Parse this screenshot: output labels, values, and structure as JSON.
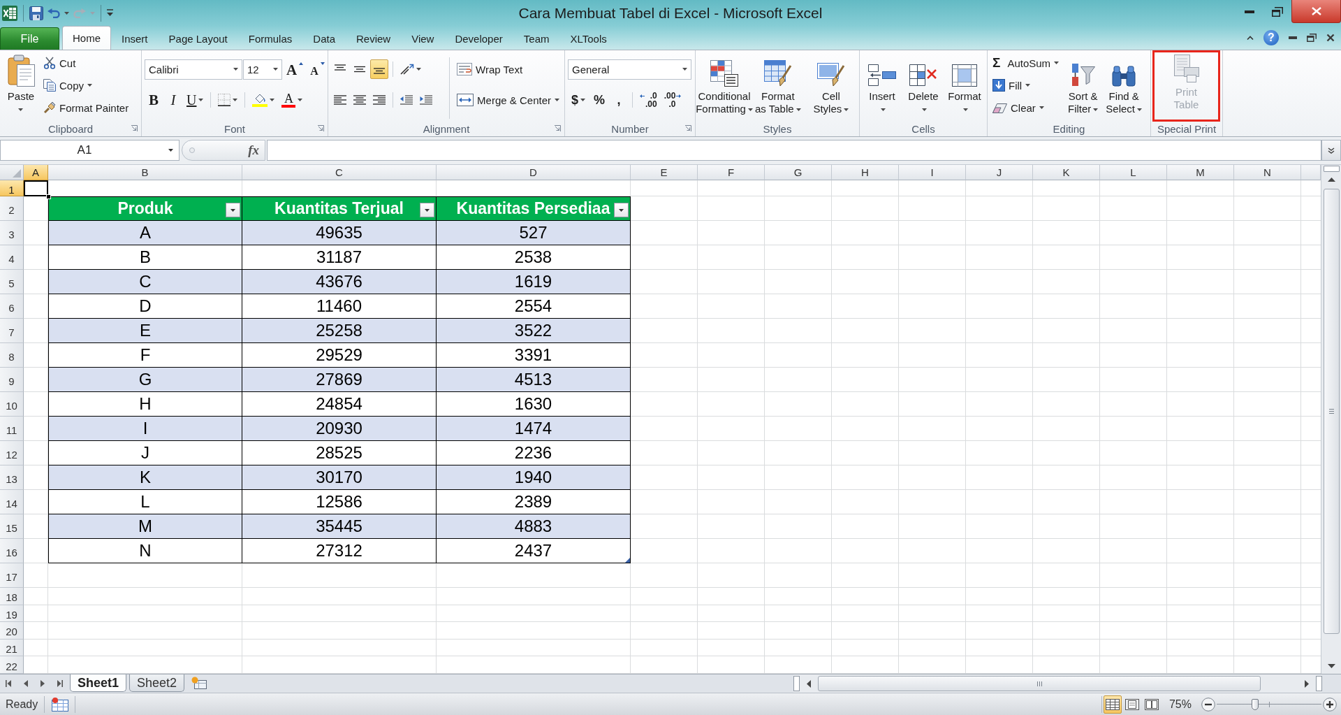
{
  "window": {
    "title": "Cara Membuat Tabel di Excel - Microsoft Excel"
  },
  "quick_access": [
    {
      "kind": "save",
      "disabled": false
    },
    {
      "kind": "undo",
      "disabled": false
    },
    {
      "kind": "redo",
      "disabled": true
    }
  ],
  "ribbon_tabs": [
    {
      "label": "File",
      "kind": "file",
      "selected": false
    },
    {
      "label": "Home",
      "kind": "tab",
      "selected": true
    },
    {
      "label": "Insert",
      "kind": "tab",
      "selected": false
    },
    {
      "label": "Page Layout",
      "kind": "tab",
      "selected": false
    },
    {
      "label": "Formulas",
      "kind": "tab",
      "selected": false
    },
    {
      "label": "Data",
      "kind": "tab",
      "selected": false
    },
    {
      "label": "Review",
      "kind": "tab",
      "selected": false
    },
    {
      "label": "View",
      "kind": "tab",
      "selected": false
    },
    {
      "label": "Developer",
      "kind": "tab",
      "selected": false
    },
    {
      "label": "Team",
      "kind": "tab",
      "selected": false
    },
    {
      "label": "XLTools",
      "kind": "tab",
      "selected": false
    }
  ],
  "help": "?",
  "ribbon": [
    {
      "kind": "clipboard",
      "label": "Clipboard",
      "launcher": true,
      "buttons": [
        {
          "label": "Paste"
        },
        {
          "label": "Cut"
        },
        {
          "label": "Copy"
        },
        {
          "label": "Format Painter"
        }
      ]
    },
    {
      "kind": "font",
      "label": "Font",
      "launcher": true,
      "font_name": "Calibri",
      "font_size": "12",
      "buttons": [
        {
          "label": "A"
        },
        {
          "label": "A"
        },
        {
          "label": "B"
        },
        {
          "label": "I"
        },
        {
          "label": "U"
        },
        {
          "label": "A"
        }
      ]
    },
    {
      "kind": "alignment",
      "label": "Alignment",
      "launcher": true,
      "align_buttons": [
        {
          "selected": false
        },
        {
          "selected": false
        },
        {
          "selected": true
        },
        {
          "selected": false
        },
        {
          "selected": false
        },
        {
          "selected": false
        }
      ],
      "buttons": [
        {
          "label": "Wrap Text"
        },
        {
          "label": "Merge & Center"
        }
      ]
    },
    {
      "kind": "number",
      "label": "Number",
      "launcher": true,
      "format": "General",
      "buttons": [
        {
          "label": "$"
        },
        {
          "label": "%"
        },
        {
          "label": ","
        },
        {
          "lines": [
            ".0",
            ".00"
          ]
        },
        {
          "lines": [
            ".00",
            ".0"
          ]
        }
      ]
    },
    {
      "kind": "styles",
      "label": "Styles",
      "launcher": false,
      "buttons": [
        {
          "lines": [
            "Conditional",
            "Formatting"
          ]
        },
        {
          "lines": [
            "Format",
            "as Table"
          ]
        },
        {
          "lines": [
            "Cell",
            "Styles"
          ]
        }
      ]
    },
    {
      "kind": "cells",
      "label": "Cells",
      "launcher": false,
      "buttons": [
        {
          "lines": [
            "Insert"
          ]
        },
        {
          "lines": [
            "Delete"
          ]
        },
        {
          "lines": [
            "Format"
          ]
        }
      ]
    },
    {
      "kind": "editing",
      "label": "Editing",
      "launcher": false,
      "buttons": [
        {
          "symbol": "Σ",
          "label": "AutoSum"
        },
        {
          "label": "Fill"
        },
        {
          "label": "Clear"
        },
        {
          "lines": [
            "Sort &",
            "Filter"
          ]
        },
        {
          "lines": [
            "Find &",
            "Select"
          ]
        }
      ]
    },
    {
      "kind": "special",
      "label": "Special Print",
      "launcher": false,
      "buttons": [
        {
          "lines": [
            "Print",
            "Table"
          ],
          "disabled": true,
          "highlighted": true
        }
      ]
    }
  ],
  "formula_bar": {
    "name_box": "A1",
    "function_label": "fx"
  },
  "sheet": {
    "columns": [
      {
        "label": "A",
        "selected": true
      },
      {
        "label": "B",
        "selected": false
      },
      {
        "label": "C",
        "selected": false
      },
      {
        "label": "D",
        "selected": false
      },
      {
        "label": "E",
        "selected": false
      },
      {
        "label": "F",
        "selected": false
      },
      {
        "label": "G",
        "selected": false
      },
      {
        "label": "H",
        "selected": false
      },
      {
        "label": "I",
        "selected": false
      },
      {
        "label": "J",
        "selected": false
      },
      {
        "label": "K",
        "selected": false
      },
      {
        "label": "L",
        "selected": false
      },
      {
        "label": "M",
        "selected": false
      },
      {
        "label": "N",
        "selected": false
      }
    ],
    "rows": [
      {
        "label": "1",
        "selected": true
      },
      {
        "label": "2",
        "selected": false
      },
      {
        "label": "3",
        "selected": false
      },
      {
        "label": "4",
        "selected": false
      },
      {
        "label": "5",
        "selected": false
      },
      {
        "label": "6",
        "selected": false
      },
      {
        "label": "7",
        "selected": false
      },
      {
        "label": "8",
        "selected": false
      },
      {
        "label": "9",
        "selected": false
      },
      {
        "label": "10",
        "selected": false
      },
      {
        "label": "11",
        "selected": false
      },
      {
        "label": "12",
        "selected": false
      },
      {
        "label": "13",
        "selected": false
      },
      {
        "label": "14",
        "selected": false
      },
      {
        "label": "15",
        "selected": false
      },
      {
        "label": "16",
        "selected": false
      },
      {
        "label": "17",
        "selected": false
      },
      {
        "label": "18",
        "selected": false
      },
      {
        "label": "19",
        "selected": false
      },
      {
        "label": "20",
        "selected": false
      },
      {
        "label": "21",
        "selected": false
      },
      {
        "label": "22",
        "selected": false
      }
    ]
  },
  "table": {
    "columns": [
      "Produk",
      "Kuantitas Terjual",
      "Kuantitas Persediaa"
    ],
    "rows": [
      [
        "A",
        "49635",
        "527"
      ],
      [
        "B",
        "31187",
        "2538"
      ],
      [
        "C",
        "43676",
        "1619"
      ],
      [
        "D",
        "11460",
        "2554"
      ],
      [
        "E",
        "25258",
        "3522"
      ],
      [
        "F",
        "29529",
        "3391"
      ],
      [
        "G",
        "27869",
        "4513"
      ],
      [
        "H",
        "24854",
        "1630"
      ],
      [
        "I",
        "20930",
        "1474"
      ],
      [
        "J",
        "28525",
        "2236"
      ],
      [
        "K",
        "30170",
        "1940"
      ],
      [
        "L",
        "12586",
        "2389"
      ],
      [
        "M",
        "35445",
        "4883"
      ],
      [
        "N",
        "27312",
        "2437"
      ]
    ]
  },
  "sheet_tabs": [
    {
      "label": "Sheet1",
      "selected": true
    },
    {
      "label": "Sheet2",
      "selected": false
    }
  ],
  "status_bar": {
    "text": "Ready",
    "views": [
      {
        "kind": "normal",
        "selected": true
      },
      {
        "kind": "page_layout",
        "selected": false
      },
      {
        "kind": "page_break",
        "selected": false
      }
    ],
    "zoom": "75%",
    "zoom_slider": {
      "level": 0.36
    }
  }
}
